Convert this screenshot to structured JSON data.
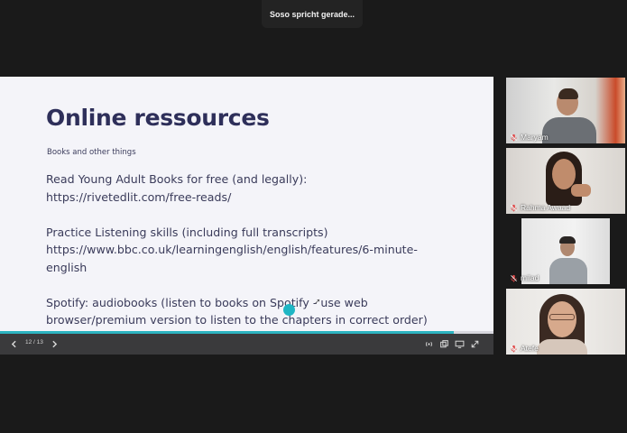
{
  "meeting": {
    "speaker_indicator": "Soso spricht gerade..."
  },
  "slide": {
    "title": "Online ressources",
    "subtitle": "Books and other things",
    "blocks": [
      [
        "Read Young Adult Books for free (and legally):",
        "https://rivetedlit.com/free-reads/"
      ],
      [
        "Practice Listening skills (including full transcripts)",
        "https://www.bbc.co.uk/learningenglish/english/features/6-minute-",
        "english"
      ],
      [
        "Spotify: audiobooks (listen to books on Spotify - use web",
        "browser/premium version to listen to the chapters in correct order)"
      ]
    ],
    "progress": 0.92,
    "accent_color": "#2cb3c0"
  },
  "presentation_controls": {
    "page_counter": "12 / 13",
    "icons": [
      "chevron-left-icon",
      "chevron-right-icon",
      "broadcast-icon",
      "copy-icon",
      "screen-icon",
      "expand-icon"
    ]
  },
  "participants": [
    {
      "name": "Maryam",
      "muted": true
    },
    {
      "name": "Rahma Awaad",
      "muted": true
    },
    {
      "name": "milad",
      "muted": true
    },
    {
      "name": "Atefe",
      "muted": true
    }
  ]
}
